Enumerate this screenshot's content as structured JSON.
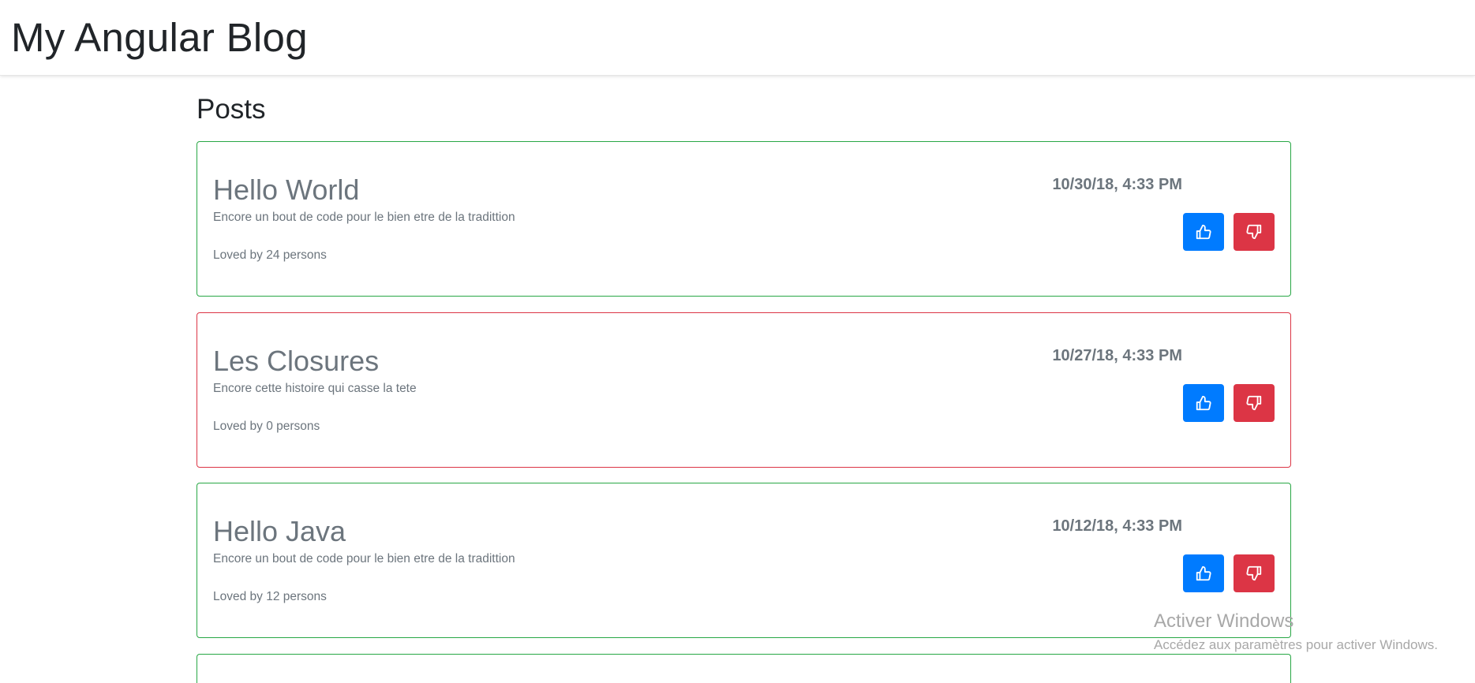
{
  "app": {
    "brand": "My Angular Blog"
  },
  "page": {
    "section_title": "Posts"
  },
  "colors": {
    "loved_border": "#28a745",
    "unloved_border": "#dc3545",
    "like_button": "#007bff",
    "dislike_button": "#dc3545"
  },
  "posts": [
    {
      "title": "Hello World",
      "content": "Encore un bout de code pour le bien etre de la tradittion",
      "loves": "Loved by 24 persons",
      "date": "10/30/18, 4:33 PM",
      "status": "loved",
      "like_icon": "thumbs-up-icon",
      "dislike_icon": "thumbs-down-icon"
    },
    {
      "title": "Les Closures",
      "content": "Encore cette histoire qui casse la tete",
      "loves": "Loved by 0 persons",
      "date": "10/27/18, 4:33 PM",
      "status": "unloved",
      "like_icon": "thumbs-up-icon",
      "dislike_icon": "thumbs-down-icon"
    },
    {
      "title": "Hello Java",
      "content": "Encore un bout de code pour le bien etre de la tradittion",
      "loves": "Loved by 12 persons",
      "date": "10/12/18, 4:33 PM",
      "status": "loved",
      "like_icon": "thumbs-up-icon",
      "dislike_icon": "thumbs-down-icon"
    },
    {
      "status": "loved"
    }
  ],
  "watermark": {
    "title": "Activer Windows",
    "subtitle": "Accédez aux paramètres pour activer Windows."
  }
}
